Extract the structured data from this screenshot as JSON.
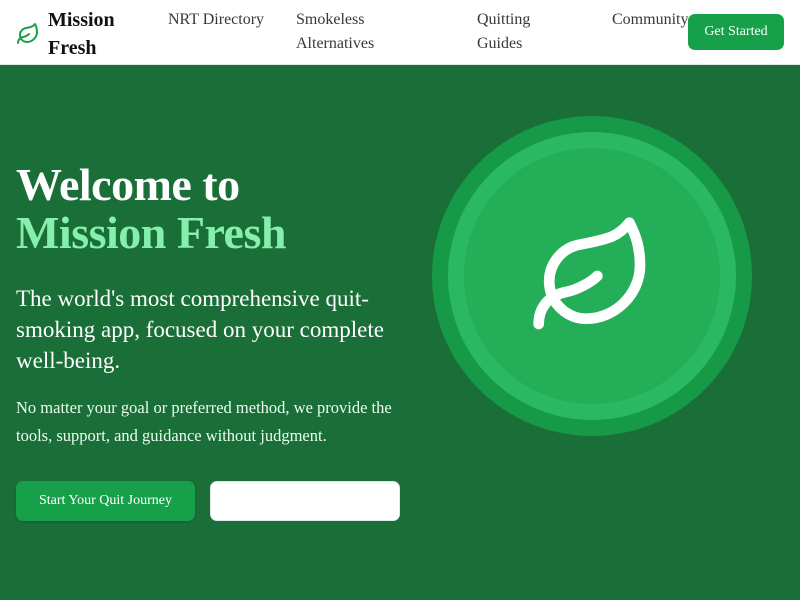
{
  "header": {
    "logo_text": "Mission Fresh",
    "logo_icon": "leaf-icon",
    "nav": [
      {
        "label": "NRT Directory"
      },
      {
        "label": "Smokeless Alternatives"
      },
      {
        "label": "Quitting Guides"
      },
      {
        "label": "Community"
      }
    ],
    "cta_label": "Get Started"
  },
  "hero": {
    "title_line1": "Welcome to",
    "title_line2": "Mission Fresh",
    "subtitle": "The world's most comprehensive quit-smoking app, focused on your complete well-being.",
    "description": "No matter your goal or preferred method, we provide the tools, support, and guidance without judgment.",
    "primary_button": "Start Your Quit Journey",
    "secondary_button": "",
    "graphic_icon": "leaf-icon"
  },
  "colors": {
    "brand_green": "#17a04a",
    "hero_bg": "#1a6e38",
    "accent_light_green": "#86efac",
    "header_bg": "#ffffff"
  }
}
